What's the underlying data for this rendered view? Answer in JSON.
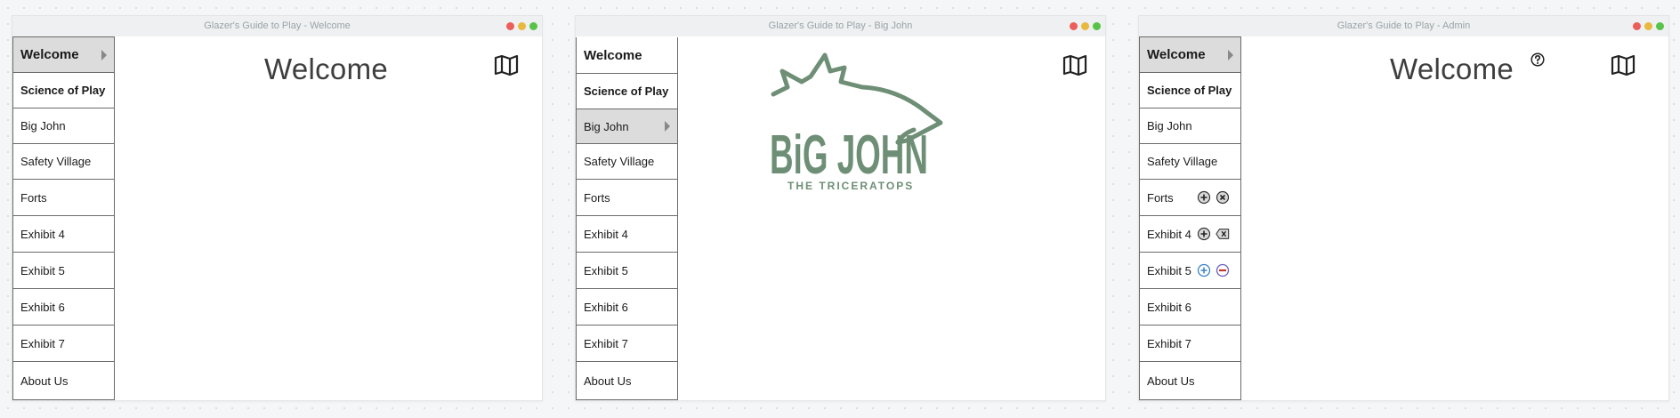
{
  "windows": [
    {
      "title": "Glazer's Guide to Play - Welcome",
      "heading": "Welcome",
      "nav": [
        {
          "label": "Welcome"
        },
        {
          "label": "Science of Play"
        },
        {
          "label": "Big John"
        },
        {
          "label": "Safety Village"
        },
        {
          "label": "Forts"
        },
        {
          "label": "Exhibit 4"
        },
        {
          "label": "Exhibit 5"
        },
        {
          "label": "Exhibit 6"
        },
        {
          "label": "Exhibit 7"
        },
        {
          "label": "About Us"
        }
      ]
    },
    {
      "title": "Glazer's Guide to Play - Big John",
      "logo": {
        "main_text": "BiG JOHN",
        "sub_text": "THE TRICERATOPS"
      },
      "nav": [
        {
          "label": "Welcome"
        },
        {
          "label": "Science of Play"
        },
        {
          "label": "Big John"
        },
        {
          "label": "Safety Village"
        },
        {
          "label": "Forts"
        },
        {
          "label": "Exhibit 4"
        },
        {
          "label": "Exhibit 5"
        },
        {
          "label": "Exhibit 6"
        },
        {
          "label": "Exhibit 7"
        },
        {
          "label": "About Us"
        }
      ]
    },
    {
      "title": "Glazer's Guide to Play - Admin",
      "heading": "Welcome",
      "nav": [
        {
          "label": "Welcome"
        },
        {
          "label": "Science of Play"
        },
        {
          "label": "Big John"
        },
        {
          "label": "Safety Village"
        },
        {
          "label": "Forts"
        },
        {
          "label": "Exhibit 4"
        },
        {
          "label": "Exhibit 5"
        },
        {
          "label": "Exhibit 6"
        },
        {
          "label": "Exhibit 7"
        },
        {
          "label": "About Us"
        }
      ]
    }
  ],
  "icons": {
    "map": "map-icon",
    "help": "question-circle-icon",
    "add": "plus-circle-icon",
    "remove": "x-circle-icon",
    "delete": "backspace-icon",
    "minus": "minus-circle-icon",
    "selected_caret": "caret-right-icon"
  },
  "colors": {
    "logo_green": "#6e8f76",
    "selected_nav_bg": "#dcdcdc",
    "add_blue": "#3b82c4",
    "remove_purple": "#6a5fc4",
    "titlebar_bg": "#eef0f1"
  }
}
